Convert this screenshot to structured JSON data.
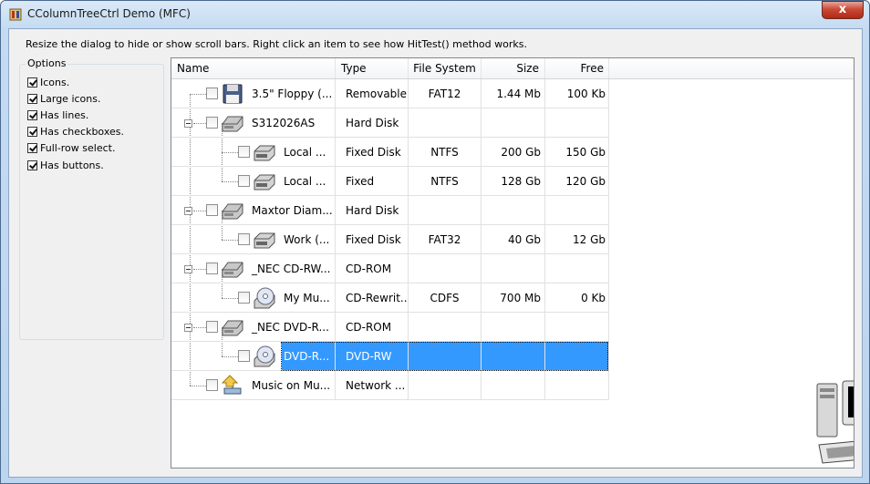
{
  "window": {
    "title": "CColumnTreeCtrl Demo (MFC)",
    "close_label": "x"
  },
  "instructions": "Resize the dialog to hide or show scroll bars. Right click an item to see how HitTest() method works.",
  "options": {
    "legend": "Options",
    "items": [
      {
        "label": "Icons.",
        "checked": true
      },
      {
        "label": "Large icons.",
        "checked": true
      },
      {
        "label": "Has lines.",
        "checked": true
      },
      {
        "label": "Has checkboxes.",
        "checked": true
      },
      {
        "label": "Full-row select.",
        "checked": true
      },
      {
        "label": "Has buttons.",
        "checked": true
      }
    ]
  },
  "tree": {
    "columns": [
      "Name",
      "Type",
      "File System",
      "Size",
      "Free"
    ],
    "rows": [
      {
        "name": "3.5\" Floppy (...",
        "type": "Removable",
        "fs": "FAT12",
        "size": "1.44 Mb",
        "free": "100 Kb",
        "icon": "floppy-icon",
        "level": 0,
        "expander": false,
        "selected": false
      },
      {
        "name": "S312026AS",
        "type": "Hard Disk",
        "fs": "",
        "size": "",
        "free": "",
        "icon": "hard-disk-icon",
        "level": 0,
        "expander": true,
        "selected": false
      },
      {
        "name": "Local ...",
        "type": "Fixed Disk",
        "fs": "NTFS",
        "size": "200 Gb",
        "free": "150 Gb",
        "icon": "drive-icon",
        "level": 1,
        "expander": false,
        "selected": false
      },
      {
        "name": "Local ...",
        "type": "Fixed",
        "fs": "NTFS",
        "size": "128 Gb",
        "free": "120 Gb",
        "icon": "drive-icon",
        "level": 1,
        "expander": false,
        "selected": false
      },
      {
        "name": "Maxtor Diam...",
        "type": "Hard Disk",
        "fs": "",
        "size": "",
        "free": "",
        "icon": "hard-disk-icon",
        "level": 0,
        "expander": true,
        "selected": false
      },
      {
        "name": "Work (...",
        "type": "Fixed Disk",
        "fs": "FAT32",
        "size": "40 Gb",
        "free": "12 Gb",
        "icon": "drive-icon",
        "level": 1,
        "expander": false,
        "selected": false
      },
      {
        "name": "_NEC CD-RW...",
        "type": "CD-ROM",
        "fs": "",
        "size": "",
        "free": "",
        "icon": "hard-disk-icon",
        "level": 0,
        "expander": true,
        "selected": false
      },
      {
        "name": "My Mu...",
        "type": "CD-Rewrit...",
        "fs": "CDFS",
        "size": "700 Mb",
        "free": "0 Kb",
        "icon": "cd-icon",
        "level": 1,
        "expander": false,
        "selected": false
      },
      {
        "name": "_NEC DVD-R...",
        "type": "CD-ROM",
        "fs": "",
        "size": "",
        "free": "",
        "icon": "hard-disk-icon",
        "level": 0,
        "expander": true,
        "selected": false
      },
      {
        "name": "DVD-R...",
        "type": "DVD-RW",
        "fs": "",
        "size": "",
        "free": "",
        "icon": "cd-icon",
        "level": 1,
        "expander": false,
        "selected": true
      },
      {
        "name": "Music on Mu...",
        "type": "Network ...",
        "fs": "",
        "size": "",
        "free": "",
        "icon": "network-drive-icon",
        "level": 0,
        "expander": false,
        "selected": false
      }
    ]
  },
  "colors": {
    "selection": "#3399ff",
    "titlebar": "#c4dbf2",
    "close_button": "#c94a36"
  }
}
